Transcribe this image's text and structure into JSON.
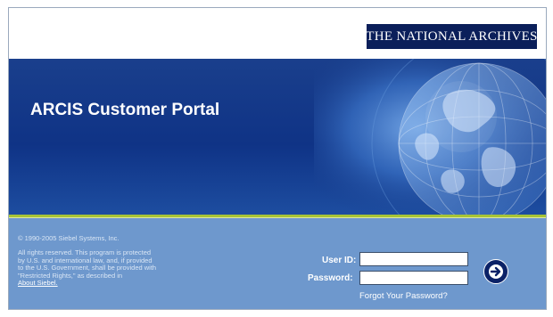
{
  "header": {
    "logo_text": "THE NATIONAL ARCHIVES"
  },
  "banner": {
    "title": "ARCIS Customer Portal",
    "graphic": "globe-graphic"
  },
  "footer": {
    "copyright": "© 1990-2005 Siebel Systems, Inc.",
    "rights_lines": [
      "All rights reserved. This program is protected",
      "by U.S. and international law, and, if provided",
      "to the U.S. Government, shall be provided with",
      "\"Restricted Rights,\" as described in"
    ],
    "about_link": "About Siebel."
  },
  "login": {
    "userid_label": "User ID:",
    "userid_value": "",
    "password_label": "Password:",
    "password_value": "",
    "forgot_link": "Forgot Your Password?",
    "go_icon": "arrow-right-icon"
  },
  "colors": {
    "banner_blue": "#0f3386",
    "footer_blue": "#6e98cd",
    "accent_green": "#a7c436",
    "logo_navy": "#0b1f5a"
  }
}
